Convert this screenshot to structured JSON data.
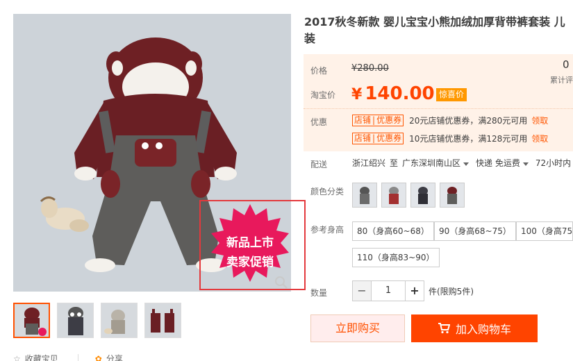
{
  "gallery": {
    "promo_line1": "新品上市",
    "promo_line2": "卖家促销",
    "share": {
      "collect": "收藏宝贝",
      "share": "分享"
    }
  },
  "product": {
    "title": "2017秋冬新款 婴儿宝宝小熊加绒加厚背带裤套装 儿装"
  },
  "price_panel": {
    "original_label": "价格",
    "original_price": "¥280.00",
    "sales_count": "0",
    "sales_label": "累计评",
    "taobao_label": "淘宝价",
    "currency": "¥",
    "price": "140.00",
    "surprise_badge": "惊喜价",
    "promo_label": "优惠",
    "coupons": [
      {
        "tag_a": "店铺",
        "tag_b": "优惠券",
        "desc": "20元店铺优惠券，满280元可用",
        "link": "领取"
      },
      {
        "tag_a": "店铺",
        "tag_b": "优惠券",
        "desc": "10元店铺优惠券，满128元可用",
        "link": "领取"
      }
    ]
  },
  "shipping": {
    "label": "配送",
    "from": "浙江绍兴",
    "to_word": "至",
    "to": "广东深圳南山区",
    "method": "快递 免运费",
    "time": "72小时内"
  },
  "sku": {
    "color_label": "颜色分类",
    "size_label": "参考身高",
    "sizes": [
      "80（身高60~68）",
      "90（身高68~75）",
      "100（身高75~",
      "110（身高83~90）"
    ]
  },
  "quantity": {
    "label": "数量",
    "value": "1",
    "minus": "−",
    "plus": "+",
    "note": "件(限购5件)"
  },
  "actions": {
    "buy_now": "立即购买",
    "add_cart": "加入购物车"
  },
  "colors": {
    "accent": "#ff4400",
    "price_bg": "#fff2e8",
    "promo_border": "#e4393c",
    "badge": "#ff9800"
  }
}
